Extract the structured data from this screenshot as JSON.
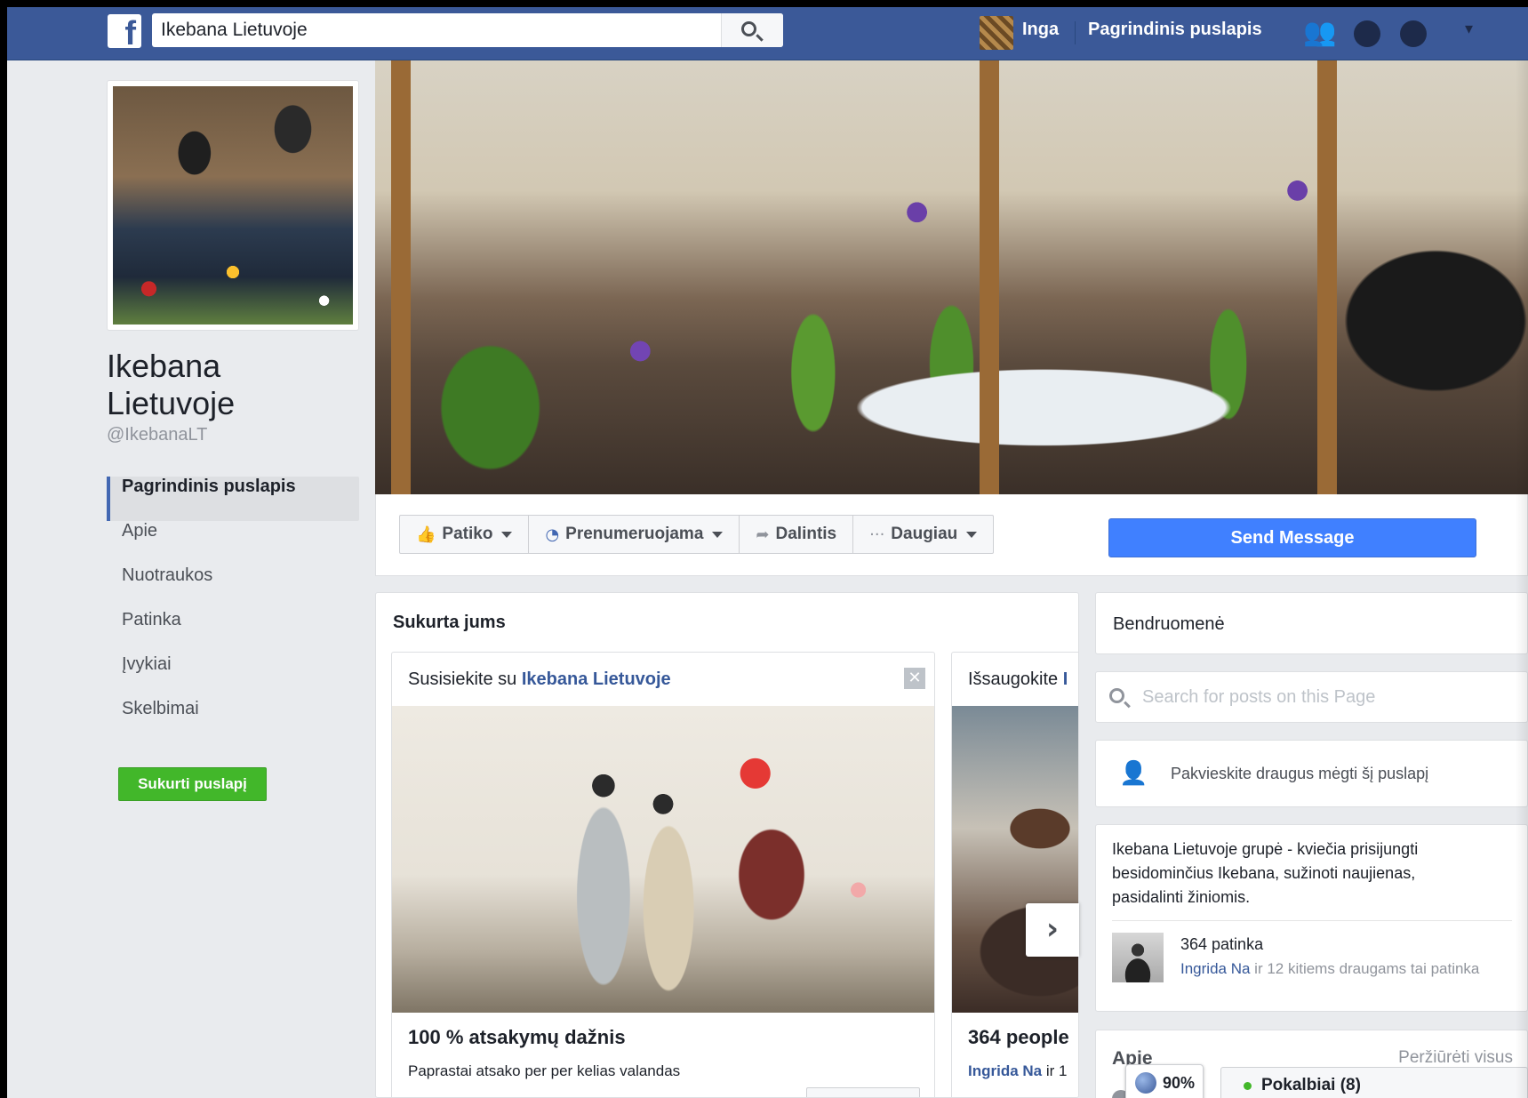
{
  "topbar": {
    "search_value": "Ikebana Lietuvoje",
    "user_name": "Inga",
    "home_link": "Pagrindinis puslapis"
  },
  "icons": {
    "logo": "facebook-logo",
    "friend_requests": "friend-requests-icon",
    "messages": "messenger-icon",
    "notifications": "notifications-icon",
    "settings": "settings-icon"
  },
  "page": {
    "name": "Ikebana Lietuvoje",
    "handle": "@IkebanaLT",
    "nav": [
      {
        "label": "Pagrindinis puslapis",
        "active": true
      },
      {
        "label": "Apie"
      },
      {
        "label": "Nuotraukos"
      },
      {
        "label": "Patinka"
      },
      {
        "label": "Įvykiai"
      },
      {
        "label": "Skelbimai"
      }
    ],
    "create_page_label": "Sukurti puslapį"
  },
  "actions": {
    "like": "Patiko",
    "follow": "Prenumeruojama",
    "share": "Dalintis",
    "more": "Daugiau",
    "send_message": "Send Message"
  },
  "for_you": {
    "title": "Sukurta jums",
    "card1": {
      "head_prefix": "Susisiekite su",
      "head_link": "Ikebana Lietuvoje",
      "stat": "100 % atsakymų dažnis",
      "sub": "Paprastai atsako per per kelias valandas"
    },
    "card2": {
      "head_prefix": "Išsaugokite",
      "head_link": "I",
      "stat": "364 people",
      "sub_link": "Ingrida Na",
      "sub_rest": " ir 1"
    }
  },
  "sidebar": {
    "community": "Bendruomenė",
    "search_placeholder": "Search for posts on this Page",
    "invite": "Pakvieskite draugus mėgti šį puslapį",
    "description": "Ikebana Lietuvoje grupė - kviečia prisijungti besidominčius Ikebana, sužinoti naujienas, pasidalinti žiniomis.",
    "likes_count": "364 patinka",
    "likes_friend": "Ingrida Na",
    "likes_rest": " ir 12 kitiems draugams tai patinka",
    "about_title": "Apie",
    "about_see_all": "Peržiūrėti visus",
    "about_fragment": "ai"
  },
  "overlay": {
    "zoom": "90%",
    "chat": "Pokalbiai (8)"
  }
}
